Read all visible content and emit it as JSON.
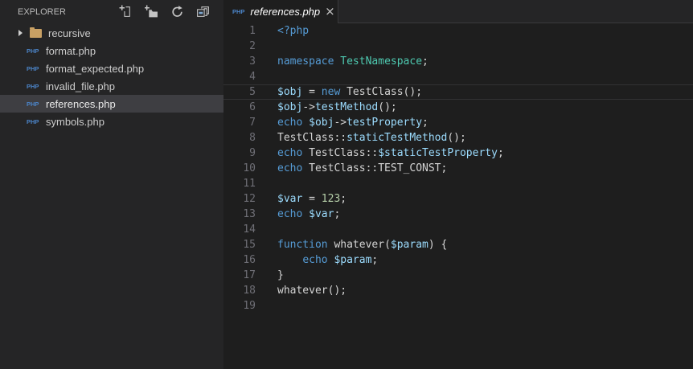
{
  "sidebar": {
    "title": "EXPLORER",
    "php_badge": "PHP",
    "actions": [
      {
        "name": "new-file"
      },
      {
        "name": "new-folder"
      },
      {
        "name": "refresh"
      },
      {
        "name": "collapse-all"
      }
    ],
    "items": [
      {
        "kind": "folder",
        "label": "recursive",
        "expanded": false
      },
      {
        "kind": "php-file",
        "label": "format.php"
      },
      {
        "kind": "php-file",
        "label": "format_expected.php"
      },
      {
        "kind": "php-file",
        "label": "invalid_file.php"
      },
      {
        "kind": "php-file",
        "label": "references.php",
        "selected": true
      },
      {
        "kind": "php-file",
        "label": "symbols.php"
      }
    ]
  },
  "tabbar": {
    "tabs": [
      {
        "icon": "PHP",
        "label": "references.php",
        "close": "×",
        "active": true,
        "preview": true
      }
    ]
  },
  "editor": {
    "lines": [
      {
        "n": 1,
        "segs": [
          [
            "kw",
            "<?php"
          ]
        ]
      },
      {
        "n": 2,
        "segs": []
      },
      {
        "n": 3,
        "segs": [
          [
            "kw",
            "namespace"
          ],
          [
            "def",
            " "
          ],
          [
            "type",
            "TestNamespace"
          ],
          [
            "def",
            ";"
          ]
        ]
      },
      {
        "n": 4,
        "segs": []
      },
      {
        "n": 5,
        "current": true,
        "segs": [
          [
            "var",
            "$obj"
          ],
          [
            "def",
            " = "
          ],
          [
            "kw",
            "new"
          ],
          [
            "def",
            " TestClass();"
          ]
        ]
      },
      {
        "n": 6,
        "segs": [
          [
            "var",
            "$obj"
          ],
          [
            "def",
            "->"
          ],
          [
            "var",
            "testMethod"
          ],
          [
            "def",
            "();"
          ]
        ]
      },
      {
        "n": 7,
        "segs": [
          [
            "kw",
            "echo"
          ],
          [
            "def",
            " "
          ],
          [
            "var",
            "$obj"
          ],
          [
            "def",
            "->"
          ],
          [
            "var",
            "testProperty"
          ],
          [
            "def",
            ";"
          ]
        ]
      },
      {
        "n": 8,
        "segs": [
          [
            "def",
            "TestClass::"
          ],
          [
            "var",
            "staticTestMethod"
          ],
          [
            "def",
            "();"
          ]
        ]
      },
      {
        "n": 9,
        "segs": [
          [
            "kw",
            "echo"
          ],
          [
            "def",
            " TestClass::"
          ],
          [
            "var",
            "$staticTestProperty"
          ],
          [
            "def",
            ";"
          ]
        ]
      },
      {
        "n": 10,
        "segs": [
          [
            "kw",
            "echo"
          ],
          [
            "def",
            " TestClass::TEST_CONST;"
          ]
        ]
      },
      {
        "n": 11,
        "segs": []
      },
      {
        "n": 12,
        "segs": [
          [
            "var",
            "$var"
          ],
          [
            "def",
            " = "
          ],
          [
            "num",
            "123"
          ],
          [
            "def",
            ";"
          ]
        ]
      },
      {
        "n": 13,
        "segs": [
          [
            "kw",
            "echo"
          ],
          [
            "def",
            " "
          ],
          [
            "var",
            "$var"
          ],
          [
            "def",
            ";"
          ]
        ]
      },
      {
        "n": 14,
        "segs": []
      },
      {
        "n": 15,
        "segs": [
          [
            "kw",
            "function"
          ],
          [
            "def",
            " whatever("
          ],
          [
            "var",
            "$param"
          ],
          [
            "def",
            ") {"
          ]
        ]
      },
      {
        "n": 16,
        "segs": [
          [
            "def",
            "    "
          ],
          [
            "kw",
            "echo"
          ],
          [
            "def",
            " "
          ],
          [
            "var",
            "$param"
          ],
          [
            "def",
            ";"
          ]
        ]
      },
      {
        "n": 17,
        "segs": [
          [
            "def",
            "}"
          ]
        ]
      },
      {
        "n": 18,
        "segs": [
          [
            "def",
            "whatever();"
          ]
        ]
      },
      {
        "n": 19,
        "segs": []
      }
    ]
  },
  "colors": {
    "editor_bg": "#1E1E1E",
    "sidebar_bg": "#252526",
    "selected_row_bg": "#3E3E42",
    "keyword": "#569CD6",
    "variable": "#9CDCFE",
    "type": "#4EC9B0",
    "number": "#B5CEA8",
    "text": "#D4D4D4",
    "line_number": "#6F6F76",
    "php_icon_blue": "#4B84C8",
    "folder_tan": "#C8A064",
    "current_line_border": "#323234"
  }
}
